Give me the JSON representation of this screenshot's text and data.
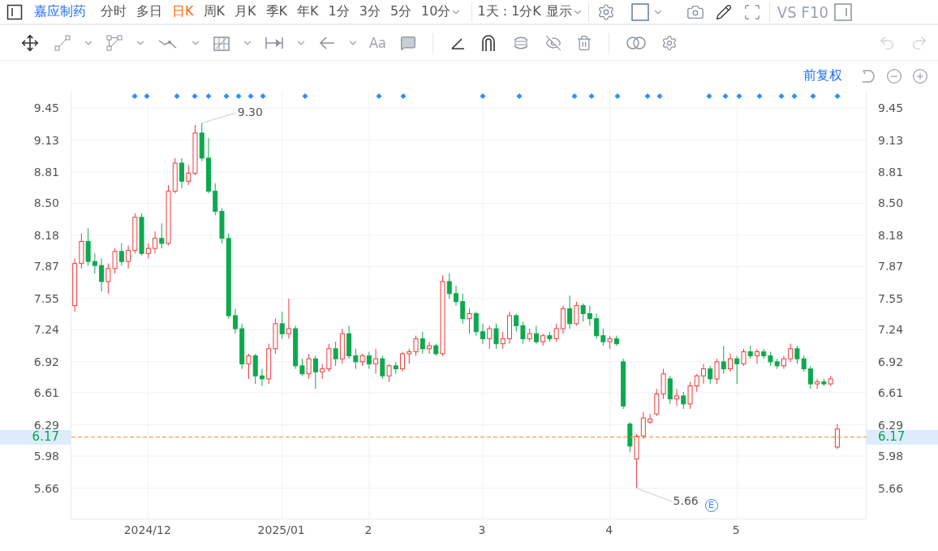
{
  "stock": {
    "name": "嘉应制药"
  },
  "periods": [
    {
      "label": "分时",
      "selected": false,
      "menu": false
    },
    {
      "label": "多日",
      "selected": false,
      "menu": false
    },
    {
      "label": "日K",
      "selected": true,
      "menu": false
    },
    {
      "label": "周K",
      "selected": false,
      "menu": false
    },
    {
      "label": "月K",
      "selected": false,
      "menu": false
    },
    {
      "label": "季K",
      "selected": false,
      "menu": false
    },
    {
      "label": "年K",
      "selected": false,
      "menu": false
    },
    {
      "label": "1分",
      "selected": false,
      "menu": false
    },
    {
      "label": "3分",
      "selected": false,
      "menu": false
    },
    {
      "label": "5分",
      "selected": false,
      "menu": false
    },
    {
      "label": "10分",
      "selected": false,
      "menu": true
    }
  ],
  "range_selector": {
    "label": "1天 : 1分K"
  },
  "display_menu": {
    "label": "显示"
  },
  "compare_buttons": [
    "VS",
    "F10"
  ],
  "text_tool": {
    "label": "Aa"
  },
  "adjust": {
    "label": "前复权"
  },
  "chart_data": {
    "type": "candlestick",
    "yticks": [
      {
        "value": 9.45,
        "label": "9.45"
      },
      {
        "value": 9.13,
        "label": "9.13"
      },
      {
        "value": 8.81,
        "label": "8.81"
      },
      {
        "value": 8.5,
        "label": "8.50"
      },
      {
        "value": 8.18,
        "label": "8.18"
      },
      {
        "value": 7.87,
        "label": "7.87"
      },
      {
        "value": 7.55,
        "label": "7.55"
      },
      {
        "value": 7.24,
        "label": "7.24"
      },
      {
        "value": 6.92,
        "label": "6.92"
      },
      {
        "value": 6.61,
        "label": "6.61"
      },
      {
        "value": 6.29,
        "label": "6.29"
      },
      {
        "value": 5.98,
        "label": "5.98"
      },
      {
        "value": 5.66,
        "label": "5.66"
      }
    ],
    "ylim": [
      5.35,
      9.62
    ],
    "grid": true,
    "ref_lines": [
      {
        "axis": "y",
        "value": 6.17,
        "color": "#f28a2e"
      }
    ],
    "categories": [
      null,
      null,
      null,
      null,
      null,
      null,
      null,
      null,
      null,
      null,
      null,
      "2024/12",
      null,
      null,
      null,
      null,
      null,
      null,
      null,
      null,
      null,
      null,
      null,
      null,
      null,
      null,
      null,
      null,
      null,
      null,
      null,
      "2025/01",
      null,
      null,
      null,
      null,
      null,
      null,
      null,
      null,
      null,
      null,
      null,
      null,
      "2",
      null,
      null,
      null,
      null,
      null,
      null,
      null,
      null,
      null,
      null,
      null,
      null,
      null,
      null,
      null,
      null,
      "3",
      null,
      null,
      null,
      null,
      null,
      null,
      null,
      null,
      null,
      null,
      null,
      null,
      null,
      null,
      null,
      null,
      null,
      null,
      "4",
      null,
      null,
      null,
      null,
      null,
      null,
      null,
      null,
      null,
      null,
      null,
      null,
      null,
      null,
      null,
      null,
      null,
      null,
      "5",
      null,
      null,
      null,
      null,
      null,
      null,
      null,
      null,
      null,
      null,
      null,
      null,
      null,
      null,
      null,
      null,
      null,
      null,
      null
    ],
    "ohlc": [
      [
        7.48,
        7.95,
        7.42,
        7.9
      ],
      [
        7.9,
        8.2,
        7.85,
        8.12
      ],
      [
        8.12,
        8.25,
        7.88,
        7.92
      ],
      [
        7.92,
        8.0,
        7.8,
        7.88
      ],
      [
        7.88,
        7.95,
        7.62,
        7.72
      ],
      [
        7.72,
        7.9,
        7.6,
        7.85
      ],
      [
        7.85,
        8.05,
        7.8,
        8.02
      ],
      [
        8.02,
        8.1,
        7.88,
        7.92
      ],
      [
        7.92,
        8.08,
        7.85,
        8.03
      ],
      [
        8.03,
        8.4,
        8.0,
        8.36
      ],
      [
        8.36,
        8.4,
        7.98,
        8.0
      ],
      [
        8.0,
        8.1,
        7.95,
        8.05
      ],
      [
        8.05,
        8.22,
        8.0,
        8.15
      ],
      [
        8.15,
        8.3,
        8.05,
        8.1
      ],
      [
        8.1,
        8.68,
        8.08,
        8.62
      ],
      [
        8.62,
        8.95,
        8.6,
        8.9
      ],
      [
        8.9,
        8.95,
        8.65,
        8.72
      ],
      [
        8.72,
        8.88,
        8.68,
        8.8
      ],
      [
        8.8,
        9.28,
        8.78,
        9.2
      ],
      [
        9.2,
        9.3,
        8.92,
        8.95
      ],
      [
        8.95,
        9.15,
        8.6,
        8.62
      ],
      [
        8.62,
        8.7,
        8.38,
        8.42
      ],
      [
        8.42,
        8.45,
        8.1,
        8.15
      ],
      [
        8.15,
        8.2,
        7.35,
        7.38
      ],
      [
        7.38,
        7.45,
        7.2,
        7.25
      ],
      [
        7.25,
        7.3,
        6.85,
        6.9
      ],
      [
        6.9,
        7.0,
        6.75,
        6.98
      ],
      [
        6.98,
        7.0,
        6.7,
        6.78
      ],
      [
        6.78,
        6.85,
        6.68,
        6.75
      ],
      [
        6.75,
        7.1,
        6.7,
        7.05
      ],
      [
        7.05,
        7.35,
        7.0,
        7.3
      ],
      [
        7.3,
        7.42,
        7.15,
        7.2
      ],
      [
        7.2,
        7.55,
        7.15,
        7.25
      ],
      [
        7.25,
        7.28,
        6.85,
        6.88
      ],
      [
        6.88,
        6.95,
        6.78,
        6.8
      ],
      [
        6.8,
        7.0,
        6.75,
        6.95
      ],
      [
        6.95,
        6.98,
        6.65,
        6.82
      ],
      [
        6.82,
        6.9,
        6.75,
        6.85
      ],
      [
        6.85,
        7.1,
        6.82,
        7.05
      ],
      [
        7.05,
        7.12,
        6.88,
        6.95
      ],
      [
        6.95,
        7.25,
        6.9,
        7.2
      ],
      [
        7.2,
        7.28,
        6.95,
        6.98
      ],
      [
        6.98,
        7.05,
        6.85,
        6.92
      ],
      [
        6.92,
        7.0,
        6.88,
        6.98
      ],
      [
        6.98,
        7.02,
        6.85,
        6.9
      ],
      [
        6.9,
        7.05,
        6.8,
        6.95
      ],
      [
        6.95,
        6.98,
        6.75,
        6.78
      ],
      [
        6.78,
        6.9,
        6.72,
        6.88
      ],
      [
        6.88,
        6.92,
        6.8,
        6.85
      ],
      [
        6.85,
        7.02,
        6.82,
        7.0
      ],
      [
        7.0,
        7.05,
        6.9,
        7.02
      ],
      [
        7.02,
        7.18,
        6.98,
        7.15
      ],
      [
        7.15,
        7.22,
        7.0,
        7.05
      ],
      [
        7.05,
        7.12,
        7.0,
        7.08
      ],
      [
        7.08,
        7.1,
        6.98,
        7.0
      ],
      [
        7.0,
        7.78,
        6.98,
        7.72
      ],
      [
        7.72,
        7.8,
        7.55,
        7.6
      ],
      [
        7.6,
        7.68,
        7.48,
        7.52
      ],
      [
        7.52,
        7.6,
        7.3,
        7.35
      ],
      [
        7.35,
        7.45,
        7.2,
        7.4
      ],
      [
        7.4,
        7.42,
        7.18,
        7.22
      ],
      [
        7.22,
        7.3,
        7.1,
        7.15
      ],
      [
        7.15,
        7.28,
        7.05,
        7.25
      ],
      [
        7.25,
        7.3,
        7.05,
        7.1
      ],
      [
        7.1,
        7.22,
        7.05,
        7.15
      ],
      [
        7.15,
        7.42,
        7.1,
        7.38
      ],
      [
        7.38,
        7.4,
        7.22,
        7.28
      ],
      [
        7.28,
        7.32,
        7.1,
        7.15
      ],
      [
        7.15,
        7.25,
        7.12,
        7.2
      ],
      [
        7.2,
        7.28,
        7.1,
        7.12
      ],
      [
        7.12,
        7.2,
        7.08,
        7.18
      ],
      [
        7.18,
        7.22,
        7.12,
        7.15
      ],
      [
        7.15,
        7.3,
        7.12,
        7.25
      ],
      [
        7.25,
        7.48,
        7.2,
        7.45
      ],
      [
        7.45,
        7.58,
        7.25,
        7.3
      ],
      [
        7.3,
        7.52,
        7.28,
        7.48
      ],
      [
        7.48,
        7.5,
        7.32,
        7.4
      ],
      [
        7.4,
        7.48,
        7.28,
        7.35
      ],
      [
        7.35,
        7.4,
        7.15,
        7.18
      ],
      [
        7.18,
        7.25,
        7.08,
        7.12
      ],
      [
        7.12,
        7.18,
        7.05,
        7.15
      ],
      [
        7.15,
        7.18,
        7.08,
        7.1
      ],
      [
        6.92,
        6.95,
        6.45,
        6.48
      ],
      [
        6.3,
        6.32,
        6.02,
        6.08
      ],
      [
        5.95,
        6.2,
        5.66,
        6.18
      ],
      [
        6.18,
        6.42,
        6.15,
        6.36
      ],
      [
        6.32,
        6.4,
        6.3,
        6.35
      ],
      [
        6.4,
        6.65,
        6.38,
        6.6
      ],
      [
        6.6,
        6.85,
        6.55,
        6.8
      ],
      [
        6.75,
        6.78,
        6.5,
        6.55
      ],
      [
        6.55,
        6.65,
        6.48,
        6.58
      ],
      [
        6.58,
        6.62,
        6.45,
        6.5
      ],
      [
        6.5,
        6.72,
        6.45,
        6.68
      ],
      [
        6.68,
        6.8,
        6.62,
        6.78
      ],
      [
        6.78,
        6.9,
        6.7,
        6.85
      ],
      [
        6.85,
        6.88,
        6.7,
        6.75
      ],
      [
        6.75,
        6.95,
        6.7,
        6.92
      ],
      [
        6.92,
        7.08,
        6.8,
        6.85
      ],
      [
        6.85,
        7.0,
        6.82,
        6.95
      ],
      [
        6.95,
        6.98,
        6.7,
        6.9
      ],
      [
        6.9,
        7.05,
        6.88,
        7.02
      ],
      [
        7.02,
        7.08,
        6.95,
        6.98
      ],
      [
        6.98,
        7.05,
        6.9,
        7.02
      ],
      [
        7.02,
        7.05,
        6.95,
        6.98
      ],
      [
        6.98,
        7.02,
        6.88,
        6.92
      ],
      [
        6.92,
        6.95,
        6.85,
        6.88
      ],
      [
        6.88,
        6.98,
        6.85,
        6.95
      ],
      [
        6.95,
        7.1,
        6.92,
        7.05
      ],
      [
        7.05,
        7.08,
        6.9,
        6.95
      ],
      [
        6.95,
        6.98,
        6.82,
        6.85
      ],
      [
        6.85,
        6.88,
        6.65,
        6.7
      ],
      [
        6.7,
        6.75,
        6.65,
        6.72
      ],
      [
        6.72,
        6.75,
        6.68,
        6.7
      ],
      [
        6.7,
        6.78,
        6.68,
        6.75
      ],
      [
        6.07,
        6.3,
        6.05,
        6.25
      ],
      null,
      null,
      null,
      null
    ]
  },
  "right_axis_labels": [
    "9.45",
    "9.13",
    "8.81",
    "8.50",
    "8.18",
    "7.87",
    "7.55",
    "7.24",
    "6.92",
    "6.61",
    "6.29",
    "5.98",
    "5.66"
  ],
  "current_price": {
    "value": "6.17"
  },
  "current_price_right": {
    "value": "6.17"
  },
  "high_marker": {
    "value": "9.30"
  },
  "low_marker": {
    "value": "5.66"
  },
  "event_marker": {
    "label": "E"
  }
}
